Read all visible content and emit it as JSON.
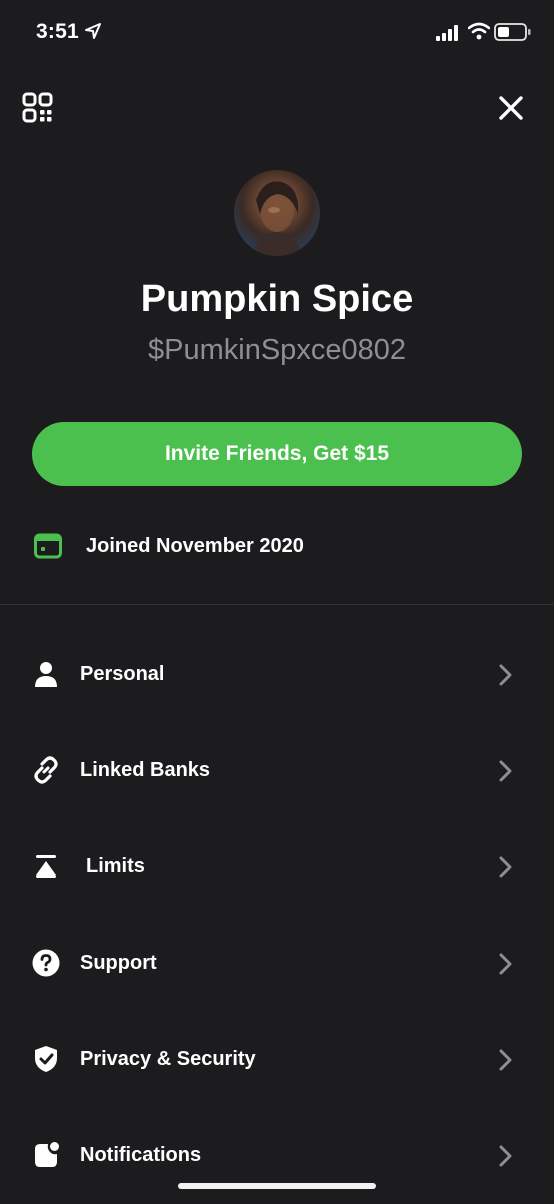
{
  "status_bar": {
    "time": "3:51",
    "location_icon": "location-arrow-icon",
    "signal_icon": "cellular-signal-icon",
    "wifi_icon": "wifi-icon",
    "battery_icon": "battery-icon"
  },
  "header": {
    "qr_icon": "qr-code-icon",
    "close_icon": "close-icon"
  },
  "profile": {
    "name": "Pumpkin Spice",
    "cashtag": "$PumkinSpxce0802"
  },
  "invite": {
    "label": "Invite Friends, Get $15",
    "color": "#4cc04f"
  },
  "joined": {
    "label": "Joined November 2020",
    "icon": "calendar-icon"
  },
  "menu": {
    "items": [
      {
        "label": "Personal",
        "icon": "person-icon"
      },
      {
        "label": "Linked Banks",
        "icon": "link-icon"
      },
      {
        "label": "Limits",
        "icon": "limits-icon"
      },
      {
        "label": "Support",
        "icon": "question-icon"
      },
      {
        "label": "Privacy & Security",
        "icon": "shield-check-icon"
      },
      {
        "label": "Notifications",
        "icon": "notification-icon"
      }
    ]
  },
  "colors": {
    "background": "#1c1c1e",
    "accent": "#4cc04f",
    "secondary_text": "#8e8e93",
    "chevron": "#8e8e93"
  }
}
